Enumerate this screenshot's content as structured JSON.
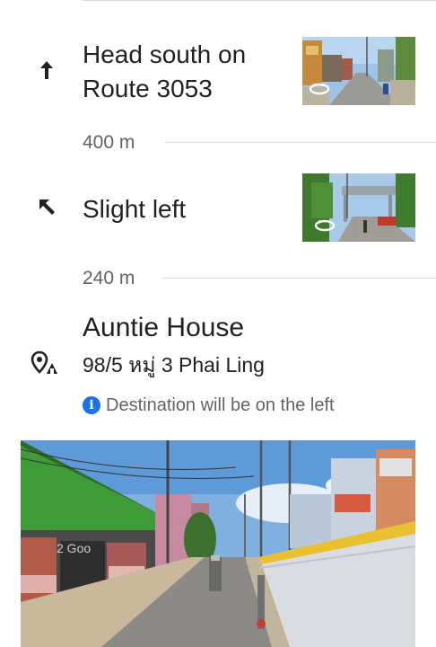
{
  "steps": [
    {
      "maneuver_icon": "arrow-up-icon",
      "instruction_line1": "Head south on",
      "instruction_line2": "Route 3053",
      "distance": "400 m",
      "thumbnail_icon": "rotate-360-icon"
    },
    {
      "maneuver_icon": "slight-left-icon",
      "instruction_line1": "Slight left",
      "distance": "240 m",
      "thumbnail_icon": "rotate-360-icon"
    }
  ],
  "destination": {
    "icon": "destination-pin-icon",
    "name": "Auntie House",
    "address": "98/5 หมู่ 3 Phai Ling",
    "note_icon": "info-icon",
    "note": "Destination will be on the left"
  },
  "streetview_watermark": "2 Goo",
  "colors": {
    "text_primary": "#202124",
    "text_secondary": "#5f6368",
    "divider": "#dadce0",
    "info_blue": "#1a73e8"
  }
}
